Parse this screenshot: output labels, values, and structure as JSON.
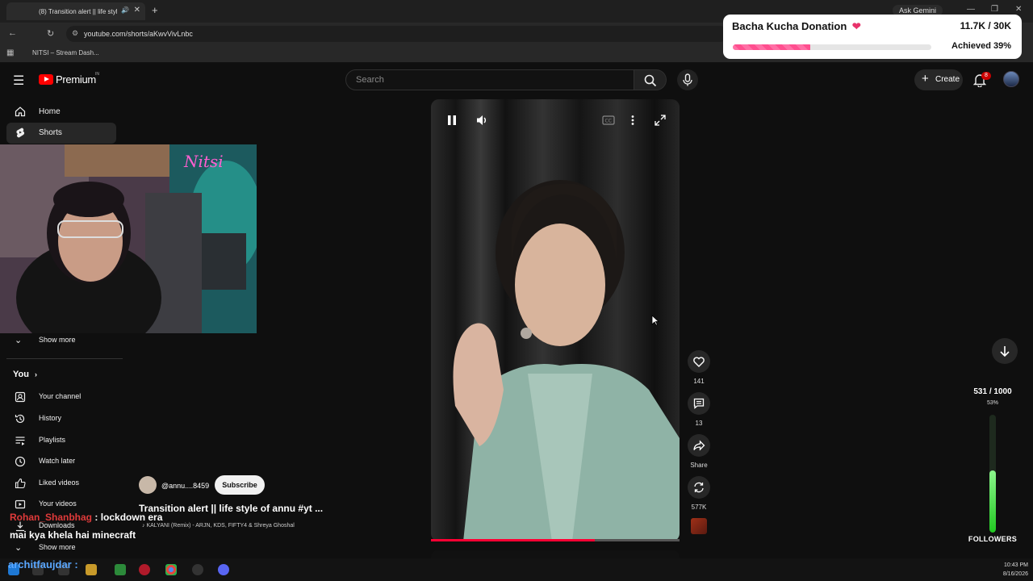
{
  "browser": {
    "tab_title": "(8) Transition alert || life styl",
    "url": "youtube.com/shorts/aKwvVivLnbc",
    "bookmark": "NITSI – Stream Dash...",
    "gemini_label": "Ask Gemini"
  },
  "youtube": {
    "logo_text": "Premium",
    "logo_region": "IN",
    "search_placeholder": "Search",
    "create_label": "Create",
    "notification_count": "8"
  },
  "sidebar": {
    "items": [
      {
        "label": "Home",
        "icon": "home-icon"
      },
      {
        "label": "Shorts",
        "icon": "shorts-icon",
        "selected": true
      }
    ],
    "show_more_1": "Show more",
    "you_section": "You",
    "you_items": [
      {
        "label": "Your channel",
        "icon": "channel-icon"
      },
      {
        "label": "History",
        "icon": "history-icon"
      },
      {
        "label": "Playlists",
        "icon": "playlists-icon"
      },
      {
        "label": "Watch later",
        "icon": "clock-icon"
      },
      {
        "label": "Liked videos",
        "icon": "thumbs-up-icon"
      },
      {
        "label": "Your videos",
        "icon": "video-icon"
      },
      {
        "label": "Downloads",
        "icon": "download-icon"
      }
    ],
    "show_more_2": "Show more"
  },
  "short": {
    "channel": "@annu....8459",
    "subscribe_label": "Subscribe",
    "title": "Transition alert || life style of annu #yt ...",
    "song": "KALYANI (Remix) - ARJN, KDS, FIFTY4 & Shreya Ghoshal",
    "like_count": "141",
    "comment_count": "13",
    "share_label": "Share",
    "remix_count": "577K",
    "progress_fraction": 0.66
  },
  "overlay": {
    "donation_title": "Bacha Kucha Donation",
    "donation_amount": "11.7K / 30K",
    "donation_achieved": "Achieved 39%",
    "donation_fraction": 0.39,
    "followers_count": "531 / 1000",
    "followers_percent": "53%",
    "followers_fraction": 0.53,
    "followers_label": "FOLLOWERS",
    "accent_pink": "#ff4f8f",
    "accent_green": "#21c821"
  },
  "chat": {
    "user1": "Rohan_Shanbhag",
    "msg1": ": lockdown era",
    "msg2": "mai kya khela hai minecraft",
    "user2": "architfaujdar :"
  },
  "taskbar": {
    "time": "10:43 PM",
    "date": "8/16/2026"
  }
}
